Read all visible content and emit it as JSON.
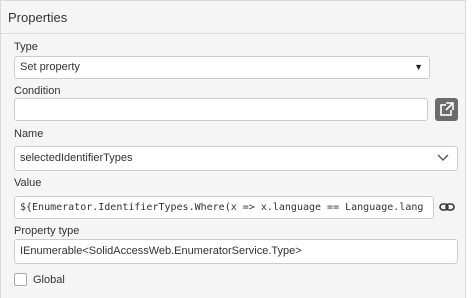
{
  "panel": {
    "title": "Properties"
  },
  "type": {
    "label": "Type",
    "value": "Set property"
  },
  "condition": {
    "label": "Condition",
    "value": ""
  },
  "name": {
    "label": "Name",
    "value": "selectedIdentifierTypes"
  },
  "value": {
    "label": "Value",
    "value": "${Enumerator.IdentifierTypes.Where(x => x.language == Language.lang"
  },
  "property_type": {
    "label": "Property type",
    "value": "IEnumerable<SolidAccessWeb.EnumeratorService.Type>"
  },
  "global": {
    "label": "Global",
    "checked": false
  },
  "icons": {
    "condition_button": "external-link-icon",
    "value_button": "link-icon",
    "type_dropdown": "caret-down-icon",
    "name_dropdown": "chevron-down-icon"
  }
}
